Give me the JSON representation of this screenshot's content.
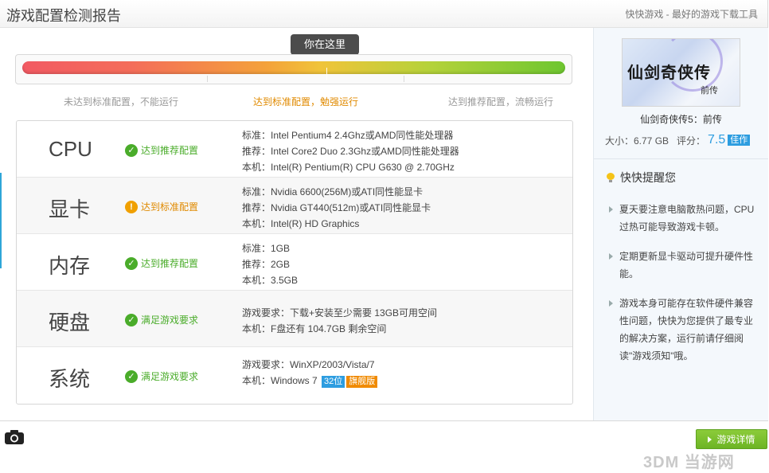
{
  "header": {
    "title": "游戏配置检测报告",
    "slogan": "快快游戏 - 最好的游戏下载工具"
  },
  "progress": {
    "pin_label": "你在这里",
    "level": 0.56,
    "labels": [
      "未达到标准配置，不能运行",
      "达到标准配置，勉强运行",
      "达到推荐配置，流畅运行"
    ]
  },
  "rows": [
    {
      "name": "CPU",
      "status": "达到推荐配置",
      "status_type": "ok",
      "lines": [
        "标准：Intel Pentium4 2.4Ghz或AMD同性能处理器",
        "推荐：Intel Core2 Duo 2.3Ghz或AMD同性能处理器",
        "本机：Intel(R) Pentium(R) CPU G630 @ 2.70GHz"
      ]
    },
    {
      "name": "显卡",
      "status": "达到标准配置",
      "status_type": "warn",
      "lines": [
        "标准：Nvidia 6600(256M)或ATI同性能显卡",
        "推荐：Nvidia GT440(512m)或ATI同性能显卡",
        "本机：Intel(R) HD Graphics"
      ]
    },
    {
      "name": "内存",
      "status": "达到推荐配置",
      "status_type": "ok",
      "lines": [
        "标准：1GB",
        "推荐：2GB",
        "本机：3.5GB"
      ]
    },
    {
      "name": "硬盘",
      "status": "满足游戏要求",
      "status_type": "ok",
      "lines": [
        "游戏要求：下载+安装至少需要 13GB可用空间",
        "本机：F盘还有 104.7GB 剩余空间"
      ]
    },
    {
      "name": "系统",
      "status": "满足游戏要求",
      "status_type": "ok",
      "lines": [
        "游戏要求：WinXP/2003/Vista/7",
        "本机：Windows 7"
      ],
      "tags": [
        "32位",
        "旗舰版"
      ]
    }
  ],
  "sidebar": {
    "cover_title": "仙剑奇侠传",
    "cover_subtitle": "前传",
    "game_name": "仙剑奇侠传5：前传",
    "size_label": "大小：6.77 GB",
    "score_label": "评分：",
    "score": "7.5",
    "score_tag": "佳作",
    "tips_title": "快快提醒您",
    "tips": [
      "夏天要注意电脑散热问题，CPU过热可能导致游戏卡顿。",
      "定期更新显卡驱动可提升硬件性能。",
      "游戏本身可能存在软件硬件兼容性问题，快快为您提供了最专业的解决方案，运行前请仔细阅读\"游戏须知\"哦。"
    ]
  },
  "footer": {
    "detail_button": "游戏详情",
    "watermark": "3DM 当游网"
  },
  "colors": {
    "ok": "#4aac2a",
    "warn": "#f0a000",
    "accent_blue": "#2d9de0",
    "button_green": "#7cbf2f"
  },
  "icons": [
    "camera-icon",
    "check-icon",
    "warning-icon",
    "bulb-icon",
    "play-triangle-icon"
  ]
}
